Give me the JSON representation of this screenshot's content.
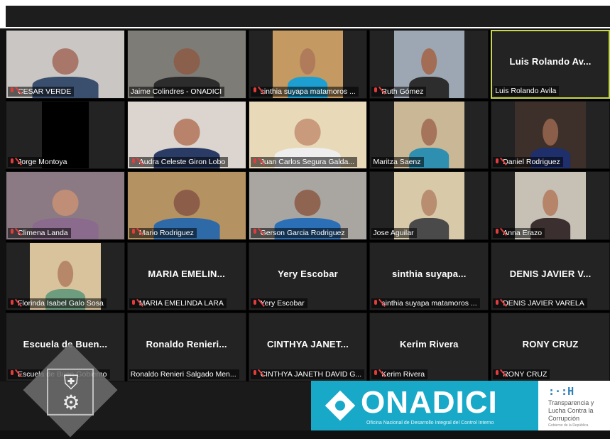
{
  "participants": [
    {
      "video": true,
      "big": "",
      "label": "CESAR VERDE",
      "muted": true,
      "bg": "#c9c6c3",
      "skin": "#a8776a",
      "shirt": "#3a4f6e"
    },
    {
      "video": true,
      "big": "",
      "label": "Jaime Colindres - ONADICI",
      "muted": false,
      "bg": "#7e7c76",
      "skin": "#8a5f4c",
      "shirt": "#2c2c2c"
    },
    {
      "video": true,
      "big": "",
      "label": "sinthia suyapa matamoros ...",
      "muted": true,
      "bg": "#c49a62",
      "skin": "#b07b5b",
      "shirt": "#1e9fd1",
      "narrow": true
    },
    {
      "video": true,
      "big": "",
      "label": "Ruth Gómez",
      "muted": true,
      "bg": "#9ca7b3",
      "skin": "#a26d54",
      "shirt": "#2d2d2d",
      "narrow": true
    },
    {
      "video": false,
      "big": "Luis Rolando Av...",
      "label": "Luis Rolando Avila",
      "muted": false,
      "active": true
    },
    {
      "video": true,
      "big": "",
      "label": "Jorge Montoya",
      "muted": true,
      "bg": "#000000",
      "skin": "#000000",
      "shirt": "#000000",
      "narrow2": true
    },
    {
      "video": true,
      "big": "",
      "label": "Audra Celeste Giron Lobo",
      "muted": true,
      "bg": "#dcd4cf",
      "skin": "#b9836b",
      "shirt": "#2a3c66"
    },
    {
      "video": true,
      "big": "",
      "label": "Juan Carlos Segura Galda...",
      "muted": true,
      "bg": "#e8d9b8",
      "skin": "#c99a7c",
      "shirt": "#eeeeee"
    },
    {
      "video": true,
      "big": "",
      "label": "Maritza Saenz",
      "muted": false,
      "bg": "#c9b795",
      "skin": "#a6745a",
      "shirt": "#2f8fb1",
      "narrow": true
    },
    {
      "video": true,
      "big": "",
      "label": "Daniel Rodriguez",
      "muted": true,
      "bg": "#3d2f2a",
      "skin": "#8a5e48",
      "shirt": "#1f2f6b",
      "narrow": true
    },
    {
      "video": true,
      "big": "",
      "label": "Climena Landa",
      "muted": true,
      "bg": "#8b7a83",
      "skin": "#c08e77",
      "shirt": "#8a6a8d"
    },
    {
      "video": true,
      "big": "",
      "label": "Mario Rodriguez",
      "muted": true,
      "bg": "#b59261",
      "skin": "#8c5e49",
      "shirt": "#2f6aa8"
    },
    {
      "video": true,
      "big": "",
      "label": "Gerson Garcia Rodriguez",
      "muted": true,
      "bg": "#a9a6a2",
      "skin": "#8f6552",
      "shirt": "#2b6fb6"
    },
    {
      "video": true,
      "big": "",
      "label": "Jose Aguilar",
      "muted": false,
      "bg": "#d8c9a9",
      "skin": "#b98d70",
      "shirt": "#4a4a4a",
      "narrow": true
    },
    {
      "video": true,
      "big": "",
      "label": "Anna Erazo",
      "muted": true,
      "bg": "#c6c0b5",
      "skin": "#b58469",
      "shirt": "#3b2f2f",
      "narrow": true
    },
    {
      "video": true,
      "big": "",
      "label": "Florinda Isabel Galo Sosa",
      "muted": true,
      "bg": "#d8c39c",
      "skin": "#b7876a",
      "shirt": "#6e9c7f",
      "narrow": true
    },
    {
      "video": false,
      "big": "MARIA EMELIN...",
      "label": "MARIA EMELINDA LARA",
      "muted": true
    },
    {
      "video": false,
      "big": "Yery Escobar",
      "label": "Yery Escobar",
      "muted": true
    },
    {
      "video": false,
      "big": "sinthia suyapa...",
      "label": "sinthia suyapa matamoros ...",
      "muted": true
    },
    {
      "video": false,
      "big": "DENIS JAVIER V...",
      "label": "DENIS JAVIER VARELA",
      "muted": true
    },
    {
      "video": false,
      "big": "Escuela de Buen...",
      "label": "Escuela de Buen Gobierno",
      "muted": true
    },
    {
      "video": false,
      "big": "Ronaldo Renieri...",
      "label": "Ronaldo Renieri Salgado Men...",
      "muted": false
    },
    {
      "video": false,
      "big": "CINTHYA JANET...",
      "label": "CINTHYA JANETH DAVID G...",
      "muted": true
    },
    {
      "video": false,
      "big": "Kerim Rivera",
      "label": "Kerim Rivera",
      "muted": true
    },
    {
      "video": false,
      "big": "RONY CRUZ",
      "label": "RONY CRUZ",
      "muted": true
    }
  ],
  "branding": {
    "onadici_name": "ONADICI",
    "onadici_sub": "Oficina Nacional de Desarrollo Integral del Control Interno",
    "tlc_mark": ":·:H",
    "tlc_line1": "Transparencia y",
    "tlc_line2": "Lucha Contra la",
    "tlc_line3": "Corrupción",
    "tlc_small": "Gobierno de la República",
    "gov_logo_icon": "shield-gears-icon"
  },
  "colors": {
    "active_border": "#c9d84a",
    "muted_mic": "#e23c3c",
    "onadici_blue": "#18a9c9"
  }
}
